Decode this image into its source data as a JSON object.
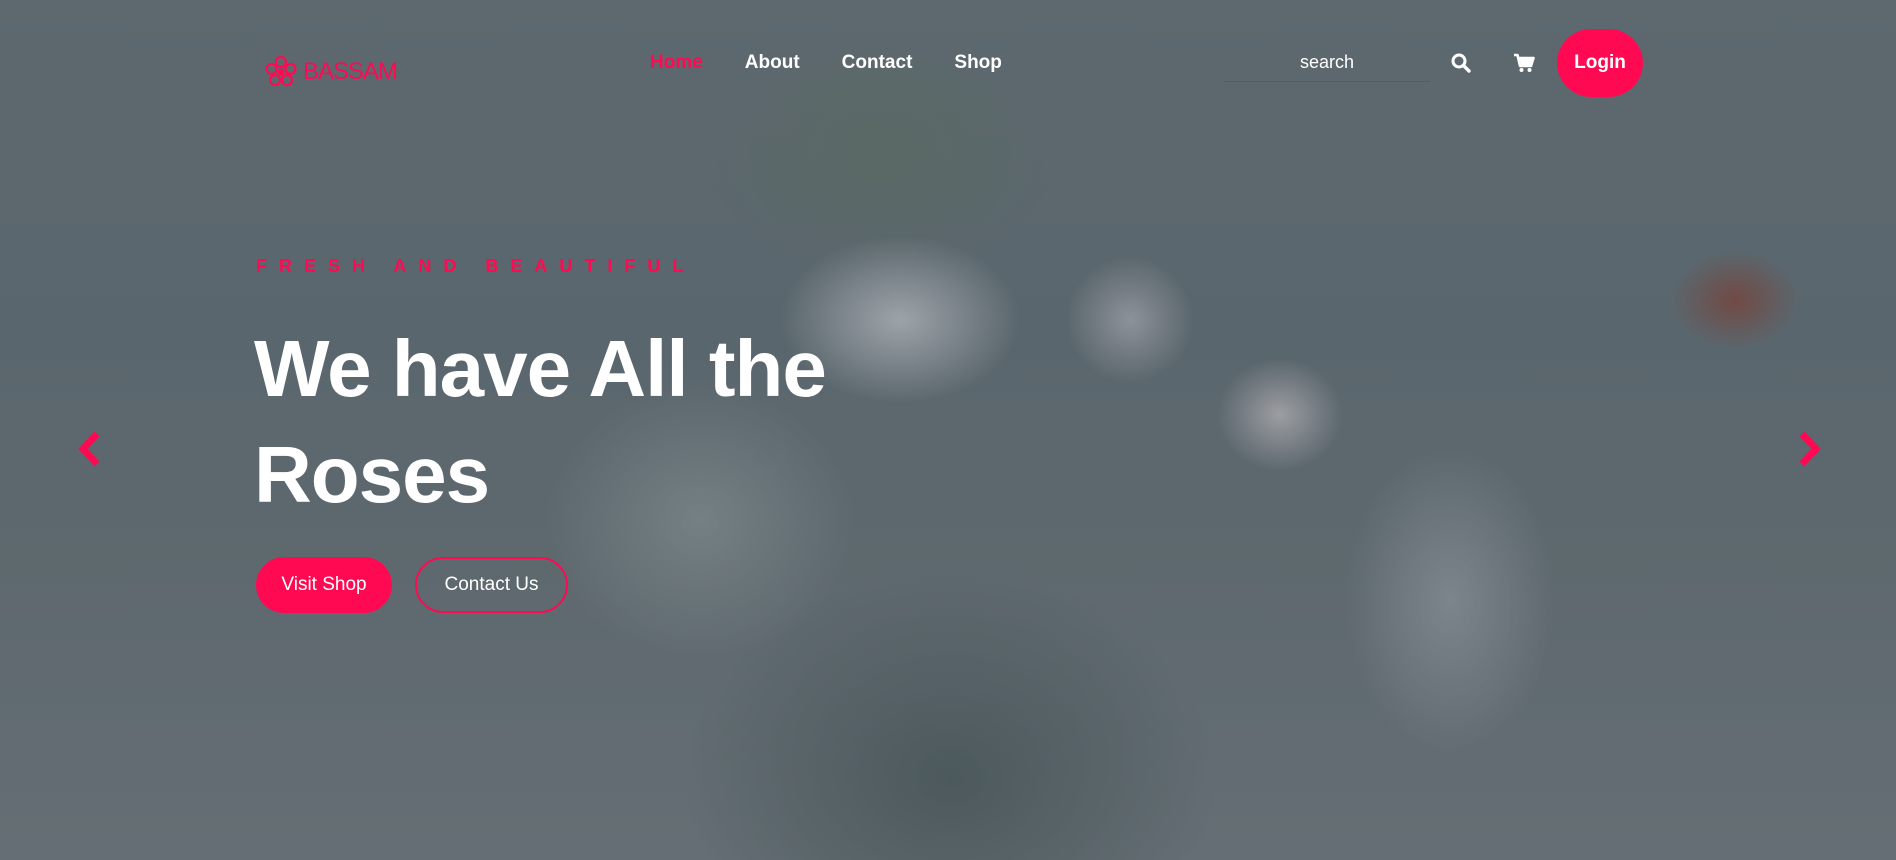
{
  "brand": {
    "name": "BASSAM",
    "accent_color": "#ff0a52",
    "logo_icon": "flower-icon"
  },
  "nav": {
    "items": [
      {
        "label": "Home",
        "active": true
      },
      {
        "label": "About",
        "active": false
      },
      {
        "label": "Contact",
        "active": false
      },
      {
        "label": "Shop",
        "active": false
      }
    ]
  },
  "search": {
    "placeholder": "search",
    "value": "",
    "icon": "search-icon"
  },
  "cart": {
    "icon": "cart-icon"
  },
  "login": {
    "label": "Login"
  },
  "hero": {
    "kicker": "FRESH AND BEAUTIFUL",
    "headline": "We have All the Roses",
    "primary_cta": "Visit Shop",
    "secondary_cta": "Contact Us"
  },
  "carousel": {
    "prev_icon": "chevron-left-icon",
    "next_icon": "chevron-right-icon"
  }
}
